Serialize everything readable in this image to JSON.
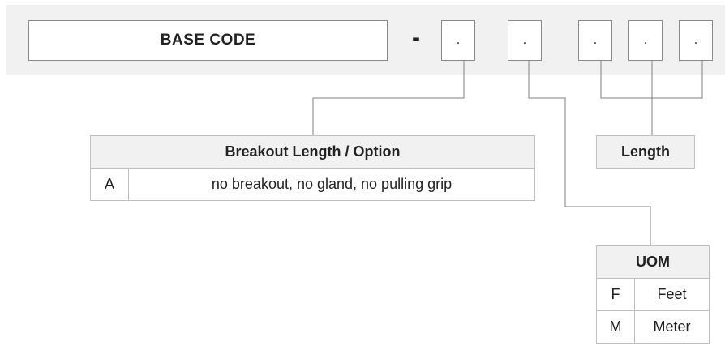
{
  "code_row": {
    "base_code": "BASE  CODE",
    "separator": "-",
    "option_slots": [
      ".",
      ".",
      ".",
      ".",
      "."
    ]
  },
  "breakout_table": {
    "header": "Breakout Length / Option",
    "rows": [
      {
        "code": "A",
        "description": "no breakout, no gland, no pulling grip"
      }
    ]
  },
  "length_table": {
    "header": "Length"
  },
  "uom_table": {
    "header": "UOM",
    "rows": [
      {
        "code": "F",
        "label": "Feet"
      },
      {
        "code": "M",
        "label": "Meter"
      }
    ]
  },
  "colors": {
    "band": "#f1f1f1",
    "box_border": "#8a8a8a",
    "connector": "#7f7f7f",
    "table_header": "#f1f1f1"
  }
}
